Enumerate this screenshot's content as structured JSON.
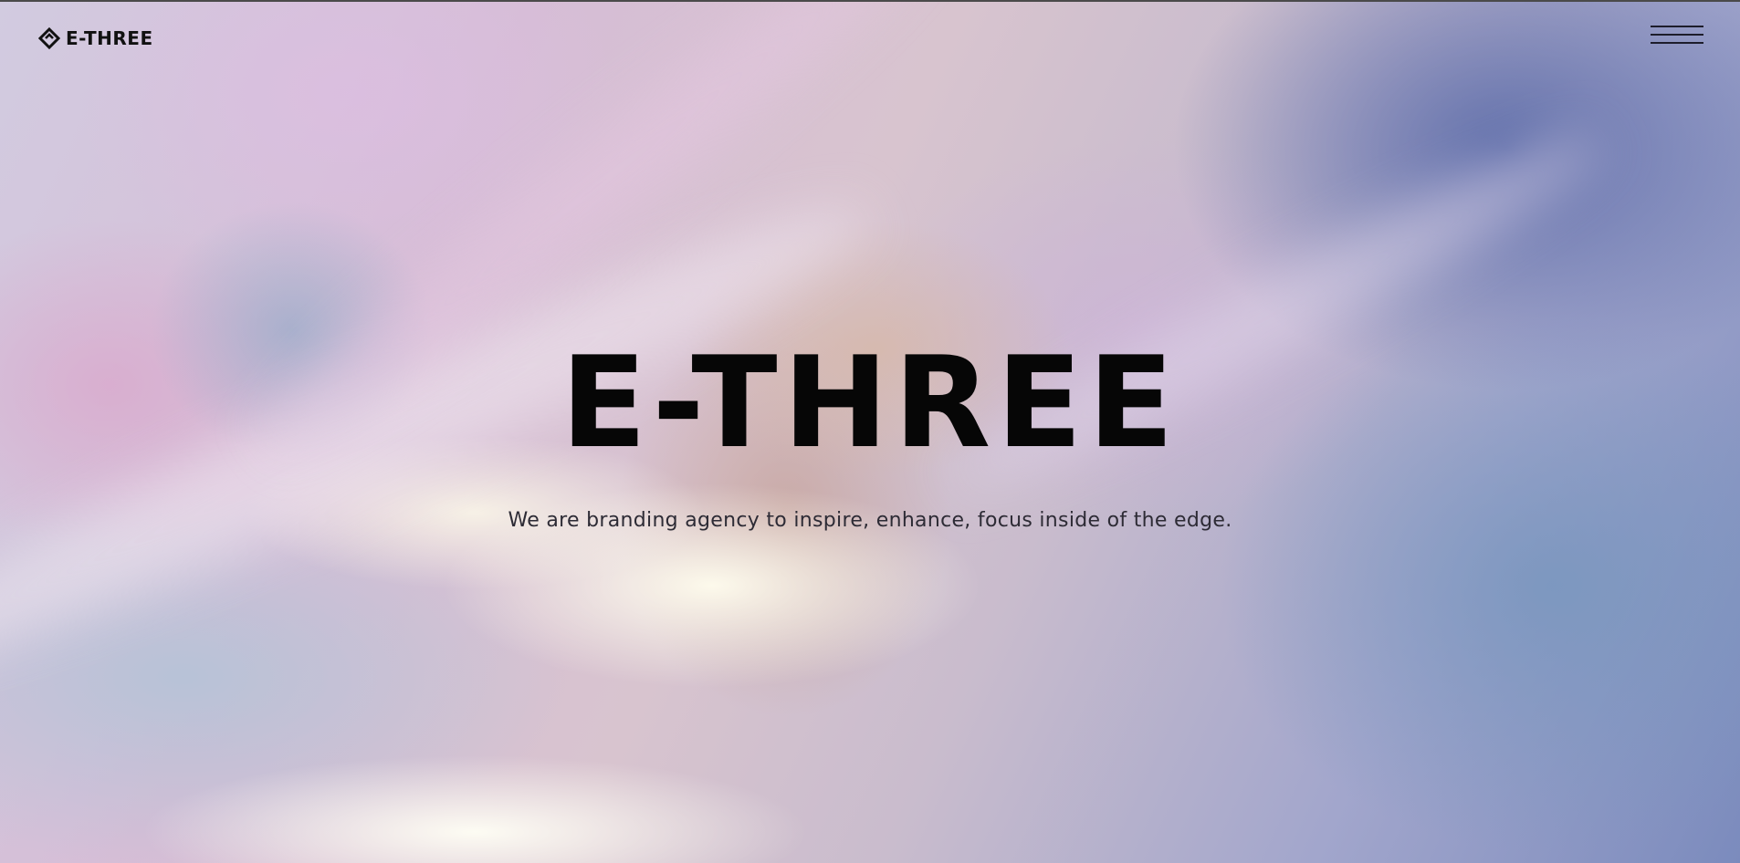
{
  "header": {
    "logo_text": "E-THREE",
    "logo_icon": "diamond-logo-icon",
    "menu_icon": "hamburger-menu-icon"
  },
  "hero": {
    "title": "E-THREE",
    "tagline": "We are branding agency to inspire, enhance, focus inside of the edge."
  },
  "colors": {
    "text_primary": "#060606",
    "text_secondary": "#2d2b35",
    "background_lavender": "#c7c2d6",
    "background_blue": "#7b8bbd",
    "background_cream": "#fffdee"
  }
}
